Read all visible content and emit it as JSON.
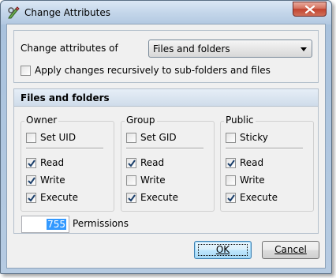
{
  "window": {
    "title": "Change Attributes",
    "icon": "gear-pencil-icon",
    "close_icon": "close-icon"
  },
  "top_group": {
    "change_label": "Change attributes of",
    "combo_value": "Files and folders",
    "recursive_label": "Apply changes recursively to sub-folders and files",
    "recursive_checked": false
  },
  "files_group": {
    "header": "Files and folders",
    "owner": {
      "title": "Owner",
      "special": {
        "label": "Set UID",
        "checked": false
      },
      "read": {
        "label": "Read",
        "checked": true
      },
      "write": {
        "label": "Write",
        "checked": true
      },
      "execute": {
        "label": "Execute",
        "checked": true
      }
    },
    "group": {
      "title": "Group",
      "special": {
        "label": "Set GID",
        "checked": false
      },
      "read": {
        "label": "Read",
        "checked": true
      },
      "write": {
        "label": "Write",
        "checked": false
      },
      "execute": {
        "label": "Execute",
        "checked": true
      }
    },
    "public": {
      "title": "Public",
      "special": {
        "label": "Sticky",
        "checked": false
      },
      "read": {
        "label": "Read",
        "checked": true
      },
      "write": {
        "label": "Write",
        "checked": false
      },
      "execute": {
        "label": "Execute",
        "checked": true
      }
    },
    "permissions_value": "755",
    "permissions_label": "Permissions"
  },
  "buttons": {
    "ok_label": "OK",
    "cancel_label": "Cancel"
  }
}
